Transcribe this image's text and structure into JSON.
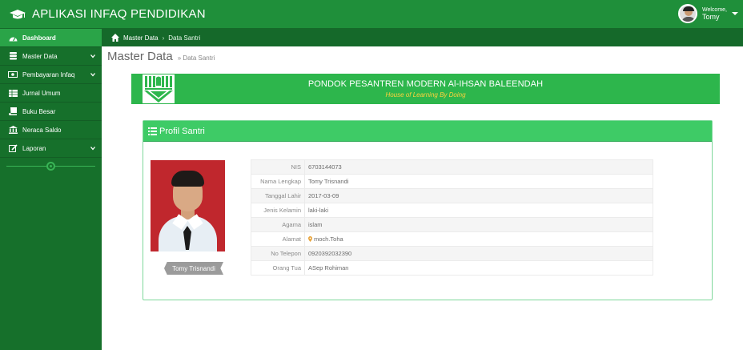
{
  "app": {
    "title": "APLIKASI INFAQ PENDIDIKAN"
  },
  "user": {
    "welcome": "Welcome,",
    "name": "Tomy"
  },
  "sidebar": {
    "items": [
      {
        "label": "Dashboard",
        "icon": "dashboard-icon",
        "active": true
      },
      {
        "label": "Master Data",
        "icon": "database-icon",
        "has_children": true
      },
      {
        "label": "Pembayaran Infaq",
        "icon": "money-icon",
        "has_children": true
      },
      {
        "label": "Jurnal Umum",
        "icon": "table-icon"
      },
      {
        "label": "Buku Besar",
        "icon": "book-icon"
      },
      {
        "label": "Neraca Saldo",
        "icon": "bank-icon"
      },
      {
        "label": "Laporan",
        "icon": "edit-icon",
        "has_children": true
      }
    ]
  },
  "breadcrumb": {
    "home": "Master Data",
    "current": "Data Santri"
  },
  "page": {
    "title": "Master Data",
    "subtitle": "» Data Santri"
  },
  "header": {
    "title": "PONDOK PESANTREN MODERN Al-IHSAN BALEENDAH",
    "tagline": "House of Learning By Doing"
  },
  "profile": {
    "heading": "Profil Santri",
    "photo_name": "Tomy Trisnandi",
    "rows": [
      {
        "label": "NIS",
        "value": "6703144073"
      },
      {
        "label": "Nama Lengkap",
        "value": "Tomy Trisnandi"
      },
      {
        "label": "Tanggal Lahir",
        "value": "2017-03-09"
      },
      {
        "label": "Jenis Kelamin",
        "value": "laki-laki"
      },
      {
        "label": "Agama",
        "value": "islam"
      },
      {
        "label": "Alamat",
        "value": "moch.Toha"
      },
      {
        "label": "No Telepon",
        "value": "0920392032390"
      },
      {
        "label": "Orang Tua",
        "value": "ASep Rohiman"
      }
    ]
  },
  "colors": {
    "topbar": "#1f8f3a",
    "sidebar": "#16702b",
    "accent": "#2db64c",
    "tagline": "#ffd23c"
  }
}
